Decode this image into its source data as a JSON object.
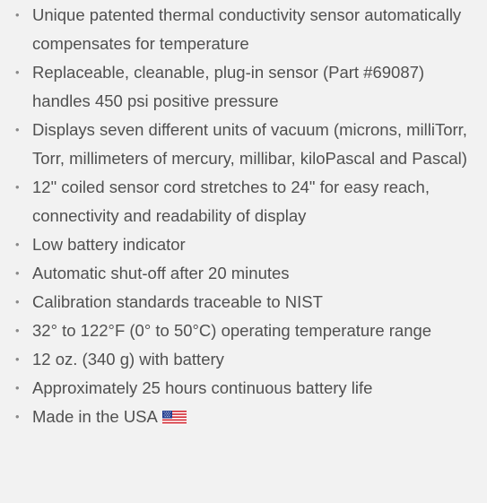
{
  "features": [
    "Unique patented thermal conductivity sensor automatically compensates for temperature",
    "Replaceable, cleanable, plug-in sensor (Part #69087) handles 450 psi positive pressure",
    "Displays seven different units of vacuum (microns, milliTorr, Torr, millimeters of mercury, millibar, kiloPascal and Pascal)",
    "12\" coiled sensor cord stretches to 24\" for easy reach, connectivity and readability of display",
    "Low battery indicator",
    "Automatic shut-off after 20 minutes",
    "Calibration standards traceable to NIST",
    "32° to 122°F (0° to 50°C) operating temperature range",
    "12 oz. (340 g) with battery",
    "Approximately 25 hours continuous battery life",
    "Made in the USA"
  ],
  "bullet_glyph": "•",
  "flag_icon": "us-flag-icon",
  "colors": {
    "background": "#f2f2f2",
    "text": "#505050",
    "bullet": "#8a8a8a"
  }
}
